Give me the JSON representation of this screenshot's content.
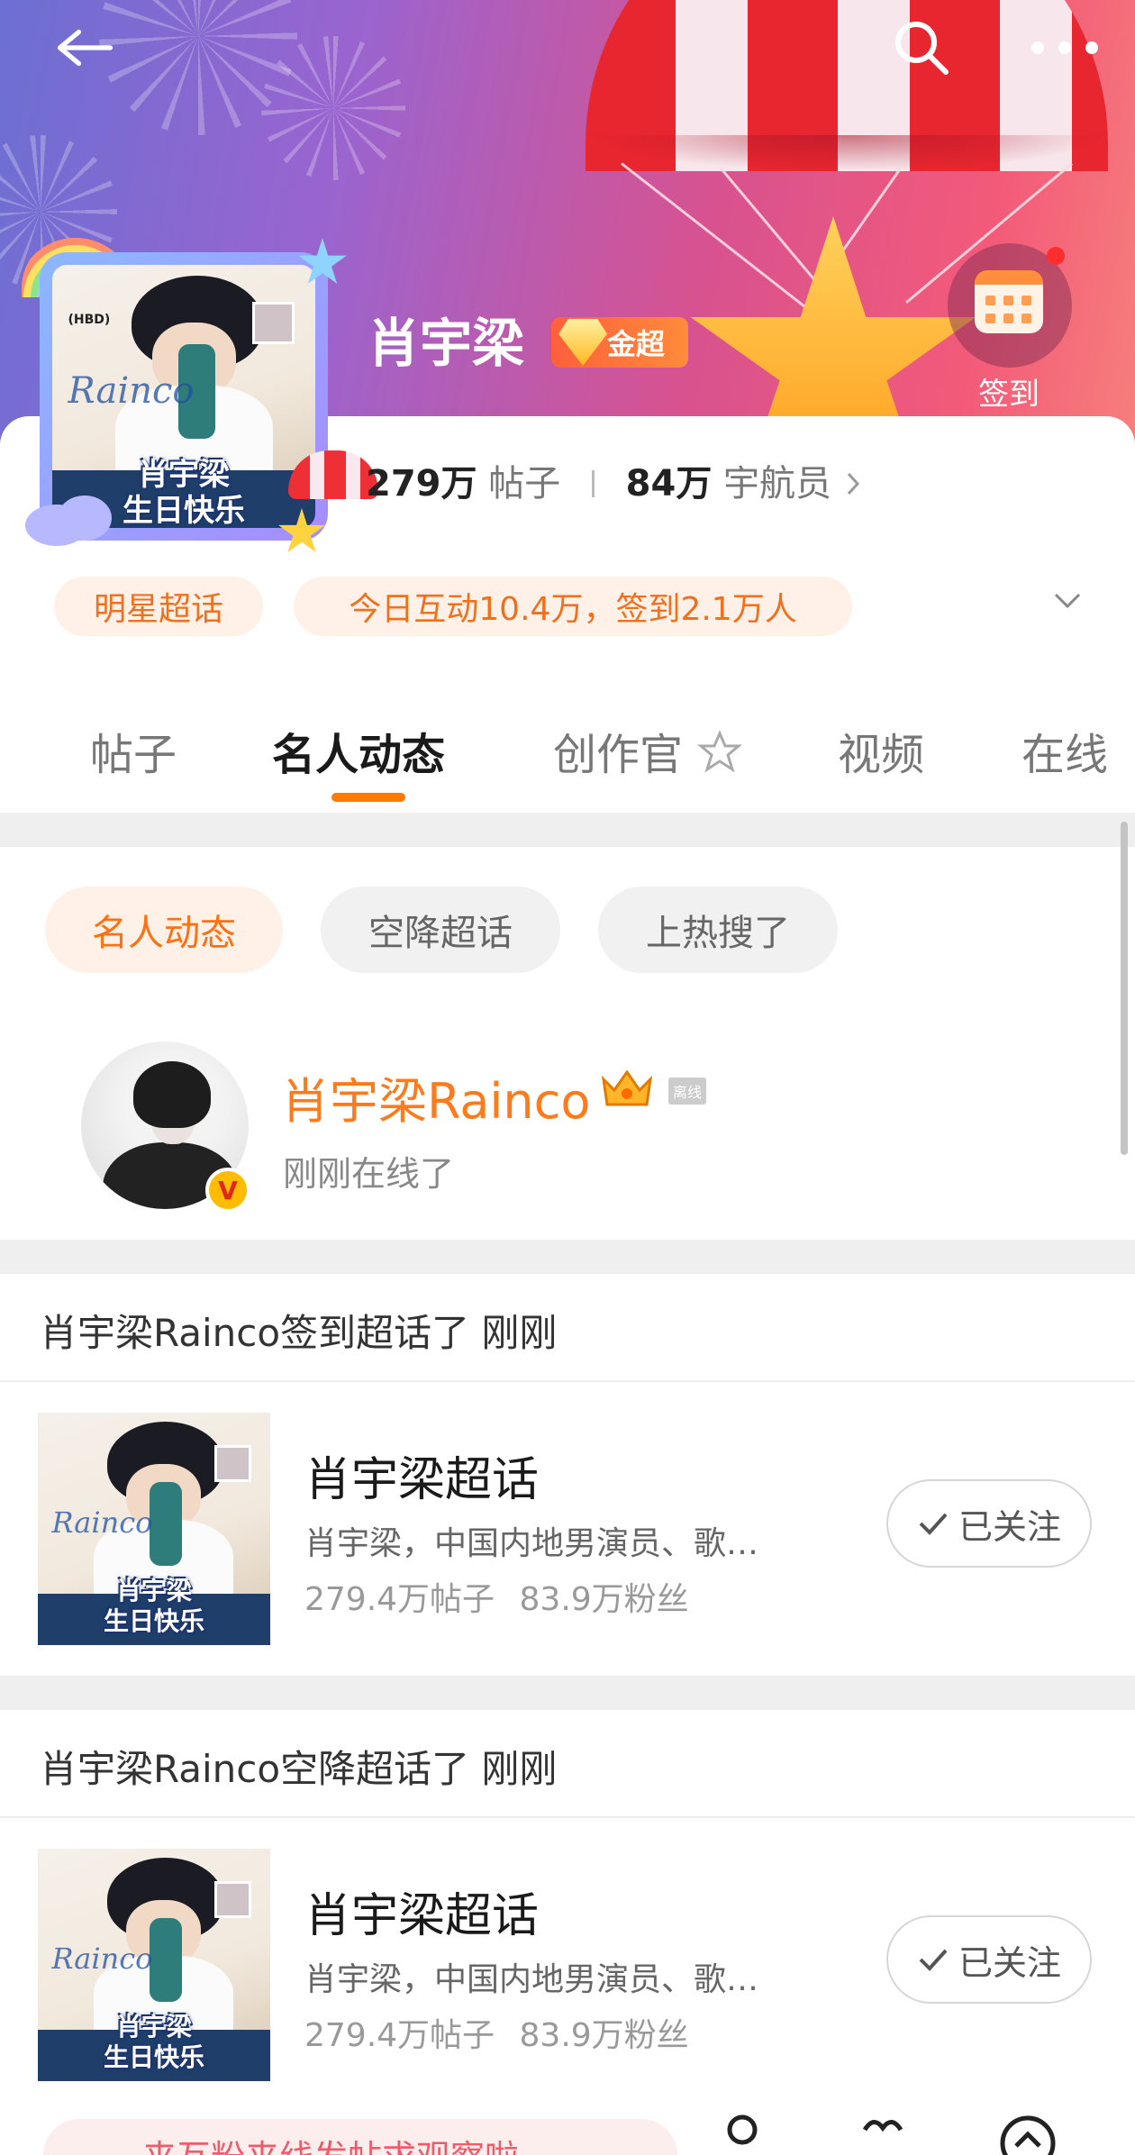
{
  "header": {
    "title": "肖宇梁",
    "level_badge": "金超",
    "checkin_label": "签到",
    "back_icon": "arrow-left-icon",
    "search_icon": "search-icon",
    "more_icon": "more-dots-icon"
  },
  "avatar_caption": {
    "line1": "肖宇梁",
    "line2": "生日快乐",
    "tag": "(HBD)",
    "script_text": "Rainco"
  },
  "stats": {
    "posts_count": "279万",
    "posts_label": "帖子",
    "members_count": "84万",
    "members_label": "宇航员"
  },
  "pills": {
    "category": "明星超话",
    "activity": "今日互动10.4万，签到2.1万人"
  },
  "tabs": [
    {
      "label": "帖子"
    },
    {
      "label": "名人动态"
    },
    {
      "label": "创作官"
    },
    {
      "label": "视频"
    },
    {
      "label": "在线"
    }
  ],
  "subtabs": [
    "名人动态",
    "空降超话",
    "上热搜了"
  ],
  "celebrity": {
    "name": "肖宇梁Rainco",
    "offline_tag": "离线",
    "status": "刚刚在线了",
    "verify_mark": "V"
  },
  "feed": [
    {
      "headline": "肖宇梁Rainco签到超话了 刚刚",
      "card_title": "肖宇梁超话",
      "card_desc": "肖宇梁，中国内地男演员、歌…",
      "card_posts": "279.4万帖子",
      "card_fans": "83.9万粉丝",
      "follow_label": "已关注"
    },
    {
      "headline": "肖宇梁Rainco空降超话了 刚刚",
      "card_title": "肖宇梁超话",
      "card_desc": "肖宇梁，中国内地男演员、歌…",
      "card_posts": "279.4万帖子",
      "card_fans": "83.9万粉丝",
      "follow_label": "已关注"
    }
  ],
  "bottom": {
    "input_text": "来互粉来线发帖求观察啦"
  },
  "colors": {
    "accent": "#ff7a00",
    "pill_bg": "#fff1e8",
    "banner_start": "#6c6fd3",
    "banner_end": "#f67f7c"
  }
}
